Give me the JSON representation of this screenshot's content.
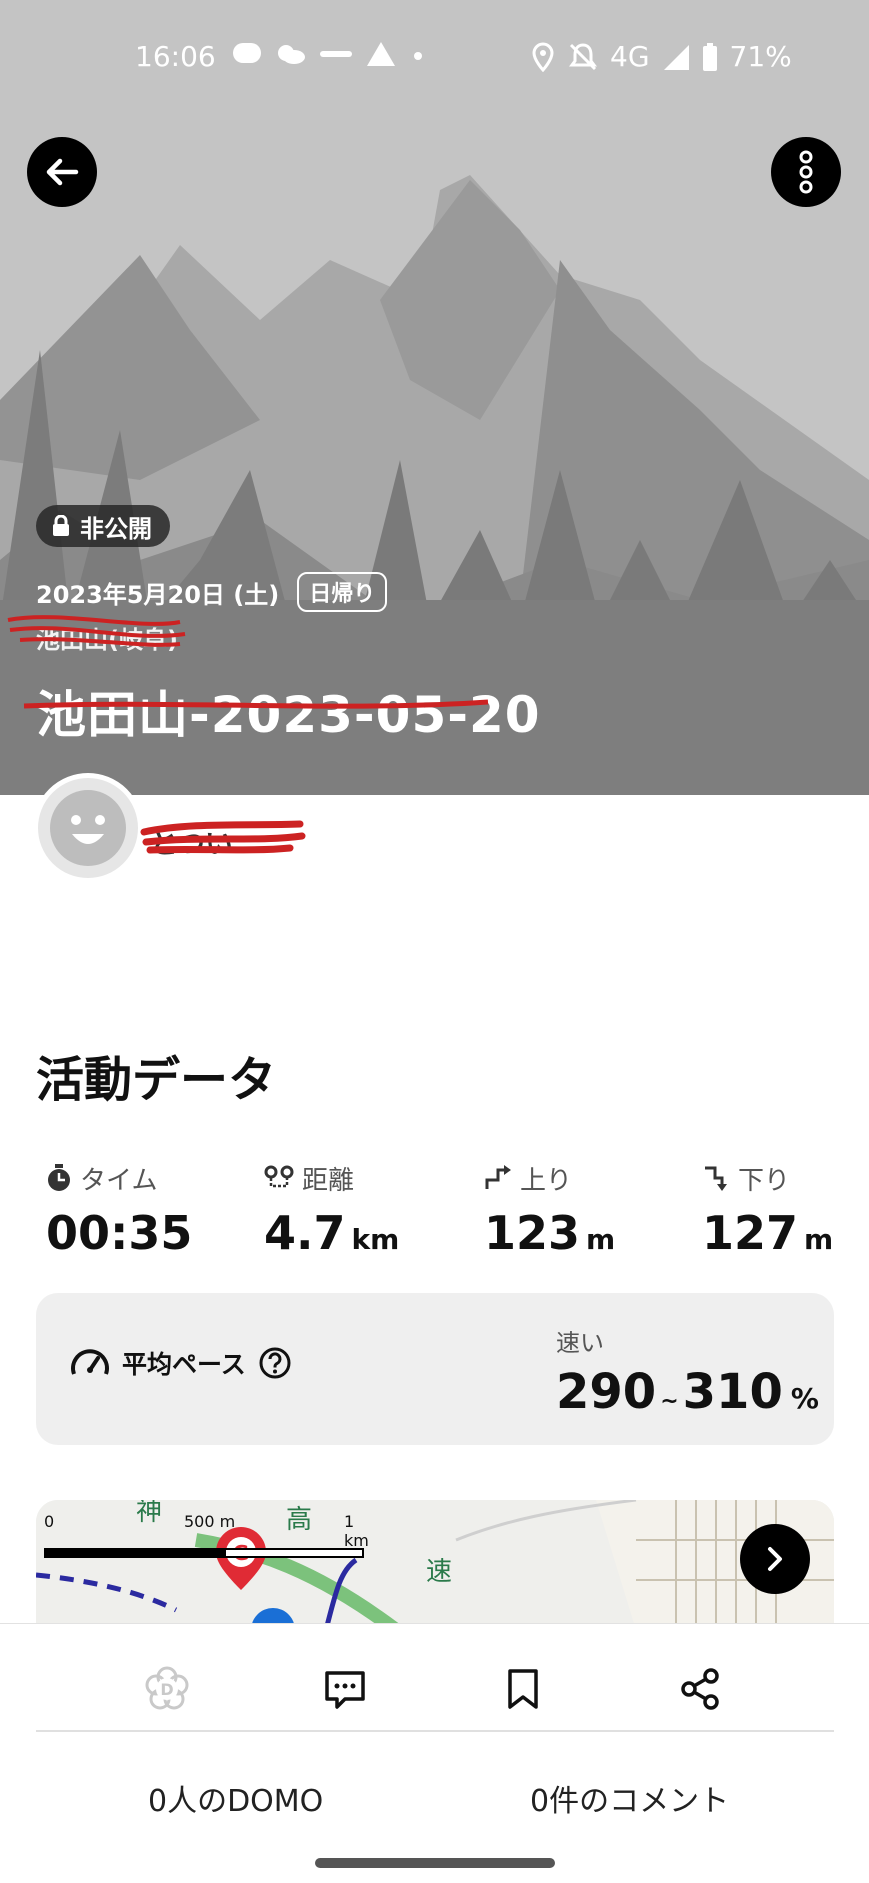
{
  "status_bar": {
    "time": "16:06",
    "network": "4G",
    "battery": "71%"
  },
  "hero": {
    "private_label": "非公開",
    "date": "2023年5月20日 (土)",
    "trip_type": "日帰り",
    "area": "池田山(岐阜)",
    "title": "池田山-2023-05-20"
  },
  "user": {
    "name": "とつい"
  },
  "activity": {
    "section_title": "活動データ",
    "stats": [
      {
        "label": "タイム",
        "value": "00:35",
        "unit": "",
        "icon": "stopwatch-icon"
      },
      {
        "label": "距離",
        "value": "4.7",
        "unit": "km",
        "icon": "distance-icon"
      },
      {
        "label": "上り",
        "value": "123",
        "unit": "m",
        "icon": "ascent-icon"
      },
      {
        "label": "下り",
        "value": "127",
        "unit": "m",
        "icon": "descent-icon"
      }
    ],
    "pace": {
      "label": "平均ペース",
      "speed_label": "速い",
      "range_low": "290",
      "tilde": "~",
      "range_high": "310",
      "unit": "%"
    }
  },
  "map": {
    "scale_labels": [
      "0",
      "500 m",
      "1 km"
    ],
    "goal_marker": "G",
    "map_text": [
      "神",
      "高",
      "速"
    ]
  },
  "bottom": {
    "domo_count": "0人のDOMO",
    "comment_count": "0件のコメント"
  },
  "colors": {
    "hero_bg": "#c3c3c3",
    "route_green": "#6bbf6b",
    "goal_red": "#e02b35",
    "redaction_red": "#cc2222"
  }
}
